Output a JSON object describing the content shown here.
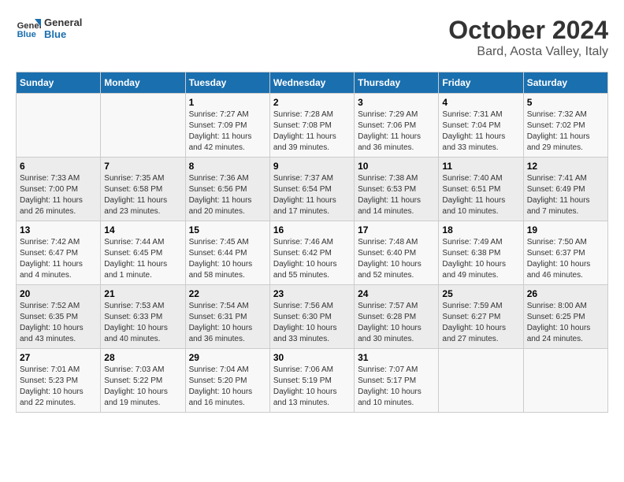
{
  "header": {
    "logo_line1": "General",
    "logo_line2": "Blue",
    "title": "October 2024",
    "subtitle": "Bard, Aosta Valley, Italy"
  },
  "weekdays": [
    "Sunday",
    "Monday",
    "Tuesday",
    "Wednesday",
    "Thursday",
    "Friday",
    "Saturday"
  ],
  "weeks": [
    [
      {
        "day": "",
        "sunrise": "",
        "sunset": "",
        "daylight": ""
      },
      {
        "day": "",
        "sunrise": "",
        "sunset": "",
        "daylight": ""
      },
      {
        "day": "1",
        "sunrise": "Sunrise: 7:27 AM",
        "sunset": "Sunset: 7:09 PM",
        "daylight": "Daylight: 11 hours and 42 minutes."
      },
      {
        "day": "2",
        "sunrise": "Sunrise: 7:28 AM",
        "sunset": "Sunset: 7:08 PM",
        "daylight": "Daylight: 11 hours and 39 minutes."
      },
      {
        "day": "3",
        "sunrise": "Sunrise: 7:29 AM",
        "sunset": "Sunset: 7:06 PM",
        "daylight": "Daylight: 11 hours and 36 minutes."
      },
      {
        "day": "4",
        "sunrise": "Sunrise: 7:31 AM",
        "sunset": "Sunset: 7:04 PM",
        "daylight": "Daylight: 11 hours and 33 minutes."
      },
      {
        "day": "5",
        "sunrise": "Sunrise: 7:32 AM",
        "sunset": "Sunset: 7:02 PM",
        "daylight": "Daylight: 11 hours and 29 minutes."
      }
    ],
    [
      {
        "day": "6",
        "sunrise": "Sunrise: 7:33 AM",
        "sunset": "Sunset: 7:00 PM",
        "daylight": "Daylight: 11 hours and 26 minutes."
      },
      {
        "day": "7",
        "sunrise": "Sunrise: 7:35 AM",
        "sunset": "Sunset: 6:58 PM",
        "daylight": "Daylight: 11 hours and 23 minutes."
      },
      {
        "day": "8",
        "sunrise": "Sunrise: 7:36 AM",
        "sunset": "Sunset: 6:56 PM",
        "daylight": "Daylight: 11 hours and 20 minutes."
      },
      {
        "day": "9",
        "sunrise": "Sunrise: 7:37 AM",
        "sunset": "Sunset: 6:54 PM",
        "daylight": "Daylight: 11 hours and 17 minutes."
      },
      {
        "day": "10",
        "sunrise": "Sunrise: 7:38 AM",
        "sunset": "Sunset: 6:53 PM",
        "daylight": "Daylight: 11 hours and 14 minutes."
      },
      {
        "day": "11",
        "sunrise": "Sunrise: 7:40 AM",
        "sunset": "Sunset: 6:51 PM",
        "daylight": "Daylight: 11 hours and 10 minutes."
      },
      {
        "day": "12",
        "sunrise": "Sunrise: 7:41 AM",
        "sunset": "Sunset: 6:49 PM",
        "daylight": "Daylight: 11 hours and 7 minutes."
      }
    ],
    [
      {
        "day": "13",
        "sunrise": "Sunrise: 7:42 AM",
        "sunset": "Sunset: 6:47 PM",
        "daylight": "Daylight: 11 hours and 4 minutes."
      },
      {
        "day": "14",
        "sunrise": "Sunrise: 7:44 AM",
        "sunset": "Sunset: 6:45 PM",
        "daylight": "Daylight: 11 hours and 1 minute."
      },
      {
        "day": "15",
        "sunrise": "Sunrise: 7:45 AM",
        "sunset": "Sunset: 6:44 PM",
        "daylight": "Daylight: 10 hours and 58 minutes."
      },
      {
        "day": "16",
        "sunrise": "Sunrise: 7:46 AM",
        "sunset": "Sunset: 6:42 PM",
        "daylight": "Daylight: 10 hours and 55 minutes."
      },
      {
        "day": "17",
        "sunrise": "Sunrise: 7:48 AM",
        "sunset": "Sunset: 6:40 PM",
        "daylight": "Daylight: 10 hours and 52 minutes."
      },
      {
        "day": "18",
        "sunrise": "Sunrise: 7:49 AM",
        "sunset": "Sunset: 6:38 PM",
        "daylight": "Daylight: 10 hours and 49 minutes."
      },
      {
        "day": "19",
        "sunrise": "Sunrise: 7:50 AM",
        "sunset": "Sunset: 6:37 PM",
        "daylight": "Daylight: 10 hours and 46 minutes."
      }
    ],
    [
      {
        "day": "20",
        "sunrise": "Sunrise: 7:52 AM",
        "sunset": "Sunset: 6:35 PM",
        "daylight": "Daylight: 10 hours and 43 minutes."
      },
      {
        "day": "21",
        "sunrise": "Sunrise: 7:53 AM",
        "sunset": "Sunset: 6:33 PM",
        "daylight": "Daylight: 10 hours and 40 minutes."
      },
      {
        "day": "22",
        "sunrise": "Sunrise: 7:54 AM",
        "sunset": "Sunset: 6:31 PM",
        "daylight": "Daylight: 10 hours and 36 minutes."
      },
      {
        "day": "23",
        "sunrise": "Sunrise: 7:56 AM",
        "sunset": "Sunset: 6:30 PM",
        "daylight": "Daylight: 10 hours and 33 minutes."
      },
      {
        "day": "24",
        "sunrise": "Sunrise: 7:57 AM",
        "sunset": "Sunset: 6:28 PM",
        "daylight": "Daylight: 10 hours and 30 minutes."
      },
      {
        "day": "25",
        "sunrise": "Sunrise: 7:59 AM",
        "sunset": "Sunset: 6:27 PM",
        "daylight": "Daylight: 10 hours and 27 minutes."
      },
      {
        "day": "26",
        "sunrise": "Sunrise: 8:00 AM",
        "sunset": "Sunset: 6:25 PM",
        "daylight": "Daylight: 10 hours and 24 minutes."
      }
    ],
    [
      {
        "day": "27",
        "sunrise": "Sunrise: 7:01 AM",
        "sunset": "Sunset: 5:23 PM",
        "daylight": "Daylight: 10 hours and 22 minutes."
      },
      {
        "day": "28",
        "sunrise": "Sunrise: 7:03 AM",
        "sunset": "Sunset: 5:22 PM",
        "daylight": "Daylight: 10 hours and 19 minutes."
      },
      {
        "day": "29",
        "sunrise": "Sunrise: 7:04 AM",
        "sunset": "Sunset: 5:20 PM",
        "daylight": "Daylight: 10 hours and 16 minutes."
      },
      {
        "day": "30",
        "sunrise": "Sunrise: 7:06 AM",
        "sunset": "Sunset: 5:19 PM",
        "daylight": "Daylight: 10 hours and 13 minutes."
      },
      {
        "day": "31",
        "sunrise": "Sunrise: 7:07 AM",
        "sunset": "Sunset: 5:17 PM",
        "daylight": "Daylight: 10 hours and 10 minutes."
      },
      {
        "day": "",
        "sunrise": "",
        "sunset": "",
        "daylight": ""
      },
      {
        "day": "",
        "sunrise": "",
        "sunset": "",
        "daylight": ""
      }
    ]
  ]
}
